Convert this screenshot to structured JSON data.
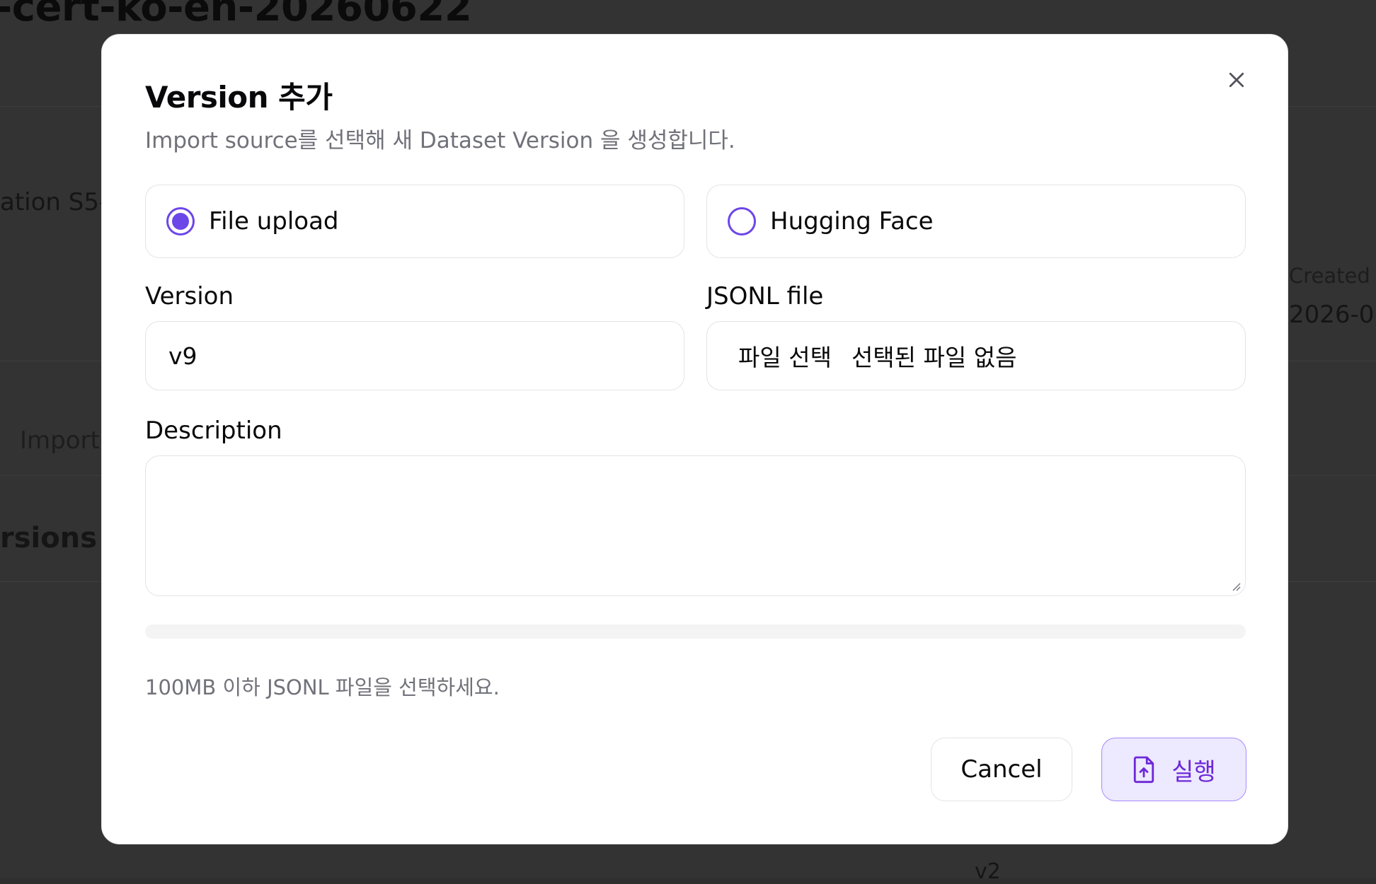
{
  "background": {
    "title": "-cert-ko-en-20260622",
    "left_text": "ation S5-",
    "import_text": "Import",
    "versions_text": "rsions",
    "created_label": "Created",
    "created_value": "2026-0",
    "bottom_text": "v2"
  },
  "modal": {
    "title": "Version 추가",
    "subtitle": "Import source를 선택해 새 Dataset Version 을 생성합니다.",
    "close_icon": "close-icon",
    "sources": [
      {
        "label": "File upload",
        "selected": true
      },
      {
        "label": "Hugging Face",
        "selected": false
      }
    ],
    "version": {
      "label": "Version",
      "value": "v9"
    },
    "file": {
      "label": "JSONL file",
      "button": "파일 선택",
      "status": "선택된 파일 없음"
    },
    "description": {
      "label": "Description",
      "value": ""
    },
    "progress": 0,
    "hint": "100MB 이하 JSONL 파일을 선택하세요.",
    "cancel_label": "Cancel",
    "run_label": "실행",
    "run_icon": "file-upload-icon",
    "accent": "#6d46e8"
  }
}
